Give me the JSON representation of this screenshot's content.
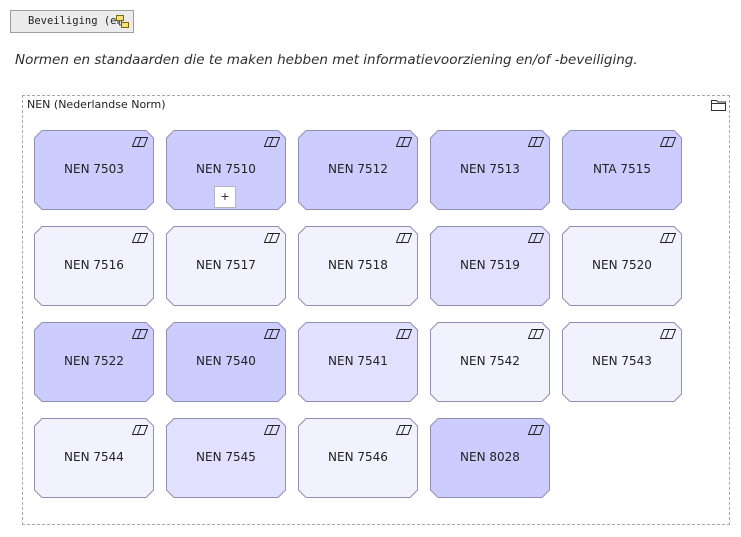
{
  "view_tab": {
    "label": "Beveiliging (en"
  },
  "description": "Normen en standaarden die te maken hebben met informatievoorziening en/of -beveiliging.",
  "group": {
    "label": "NEN (Nederlandse Norm)",
    "icon": "folder-icon"
  },
  "colors": {
    "dark": "#ccccff",
    "medium": "#e1e1ff",
    "light": "#f2f2ff",
    "border": "#8f8fb5"
  },
  "elements": [
    {
      "label": "NEN 7503",
      "shade": "dark"
    },
    {
      "label": "NEN 7510",
      "shade": "dark",
      "expand": "+"
    },
    {
      "label": "NEN 7512",
      "shade": "dark"
    },
    {
      "label": "NEN 7513",
      "shade": "dark"
    },
    {
      "label": "NTA 7515",
      "shade": "dark"
    },
    {
      "label": "NEN 7516",
      "shade": "light"
    },
    {
      "label": "NEN 7517",
      "shade": "light"
    },
    {
      "label": "NEN 7518",
      "shade": "light"
    },
    {
      "label": "NEN 7519",
      "shade": "medium"
    },
    {
      "label": "NEN 7520",
      "shade": "light"
    },
    {
      "label": "NEN 7522",
      "shade": "dark"
    },
    {
      "label": "NEN 7540",
      "shade": "dark"
    },
    {
      "label": "NEN 7541",
      "shade": "medium"
    },
    {
      "label": "NEN 7542",
      "shade": "light"
    },
    {
      "label": "NEN 7543",
      "shade": "light"
    },
    {
      "label": "NEN 7544",
      "shade": "light"
    },
    {
      "label": "NEN 7545",
      "shade": "medium"
    },
    {
      "label": "NEN 7546",
      "shade": "light"
    },
    {
      "label": "NEN 8028",
      "shade": "dark"
    }
  ]
}
